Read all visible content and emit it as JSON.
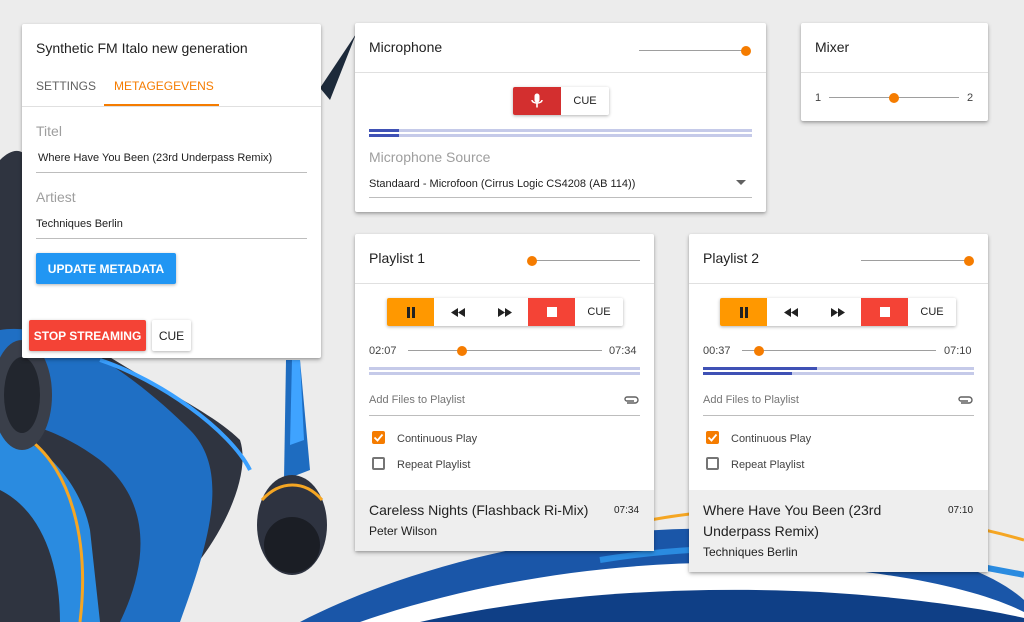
{
  "metadata_card": {
    "title": "Synthetic FM Italo new generation",
    "tabs": [
      {
        "label": "SETTINGS",
        "active": false
      },
      {
        "label": "METAGEGEVENS",
        "active": true
      }
    ],
    "titel_label": "Titel",
    "titel_value": "Where Have You Been (23rd Underpass Remix)",
    "artiest_label": "Artiest",
    "artiest_value": "Techniques Berlin",
    "update_label": "UPDATE METADATA",
    "stop_label": "STOP STREAMING",
    "cue_label": "CUE"
  },
  "microphone": {
    "title": "Microphone",
    "volume": 0.97,
    "cue_label": "CUE",
    "source_label": "Microphone Source",
    "source_value": "Standaard - Microfoon (Cirrus Logic CS4208 (AB 114))"
  },
  "mixer": {
    "title": "Mixer",
    "left_label": "1",
    "right_label": "2",
    "position": 0.5
  },
  "playlists": [
    {
      "title": "Playlist 1",
      "volume": 0.0,
      "cue_label": "CUE",
      "elapsed": "02:07",
      "total": "07:34",
      "progress": 0.28,
      "level_top": 0.0,
      "level_bottom": 0.0,
      "add_files": "Add Files to Playlist",
      "continuous_label": "Continuous Play",
      "continuous": true,
      "repeat_label": "Repeat Playlist",
      "repeat": false,
      "track_title": "Careless Nights (Flashback Ri-Mix)",
      "track_artist": "Peter Wilson",
      "track_duration": "07:34"
    },
    {
      "title": "Playlist 2",
      "volume": 1.0,
      "cue_label": "CUE",
      "elapsed": "00:37",
      "total": "07:10",
      "progress": 0.09,
      "level_top": 0.42,
      "level_bottom": 0.33,
      "add_files": "Add Files to Playlist",
      "continuous_label": "Continuous Play",
      "continuous": true,
      "repeat_label": "Repeat Playlist",
      "repeat": false,
      "track_title": "Where Have You Been (23rd Underpass Remix)",
      "track_artist": "Techniques Berlin",
      "track_duration": "07:10"
    }
  ],
  "colors": {
    "accent": "#f57c00",
    "primary_button": "#2196f3",
    "danger": "#f44336",
    "pause": "#ff9800",
    "level_fill": "#3f51b5",
    "level_track": "#c5cae9"
  },
  "icons": [
    "pause-icon",
    "rewind-icon",
    "fast-forward-icon",
    "stop-icon",
    "microphone-icon",
    "dropdown-arrow-icon",
    "paperclip-icon"
  ]
}
